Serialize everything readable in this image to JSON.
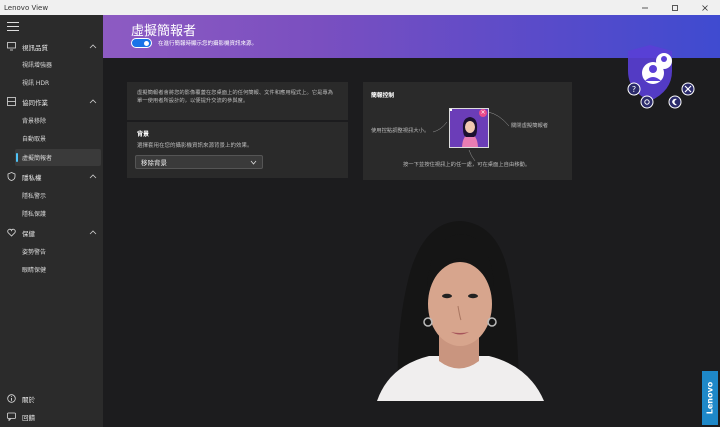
{
  "window": {
    "title": "Lenovo View",
    "minimize_icon": "minimize-icon",
    "maximize_icon": "maximize-icon",
    "close_icon": "close-icon"
  },
  "sidebar": {
    "menu_icon": "hamburger-icon",
    "groups": [
      {
        "label": "視訊品質",
        "icon": "monitor-icon",
        "expanded": true,
        "items": [
          {
            "label": "視訊增強器"
          },
          {
            "label": "視訊 HDR"
          }
        ]
      },
      {
        "label": "協同作業",
        "icon": "collaboration-icon",
        "expanded": true,
        "items": [
          {
            "label": "背景移除"
          },
          {
            "label": "自動取景"
          },
          {
            "label": "虛擬簡報者",
            "active": true
          }
        ]
      },
      {
        "label": "隱私權",
        "icon": "privacy-shield-icon",
        "expanded": true,
        "items": [
          {
            "label": "隱私警示"
          },
          {
            "label": "隱私保護"
          }
        ]
      },
      {
        "label": "保健",
        "icon": "health-icon",
        "expanded": true,
        "items": [
          {
            "label": "姿勢警告"
          },
          {
            "label": "眼睛保健"
          }
        ]
      }
    ],
    "bottom": [
      {
        "label": "關於",
        "icon": "info-icon"
      },
      {
        "label": "回饋",
        "icon": "feedback-icon"
      }
    ]
  },
  "header": {
    "title": "虛擬簡報者",
    "toggle_on": true,
    "toggle_label": "在進行簡報時顯示您的攝影機資訊來源。"
  },
  "description": "虛擬簡報者會將您的影像覆蓋在您桌面上的任何簡報、文件和應用程式上。它是專為單一使用者所設計的，以便提升交流的參與度。",
  "background": {
    "label": "背景",
    "subtext": "選擇套用在您的攝影機資訊來源背景上的效果。",
    "selected": "移除背景"
  },
  "controls": {
    "label": "簡報控制",
    "resize_text": "使用控點調整視訊大小。",
    "close_text": "關閉虛擬簡報者",
    "move_text": "按一下並按住視訊上的任一處，可在桌面上自由移動。"
  },
  "brand": {
    "label": "Lenovo",
    "color": "#1e88c8"
  },
  "colors": {
    "toggle": "#1a73e8",
    "active_indicator": "#4fc3f7",
    "header_start": "#8d5bc2",
    "header_end": "#3f4bd0"
  }
}
